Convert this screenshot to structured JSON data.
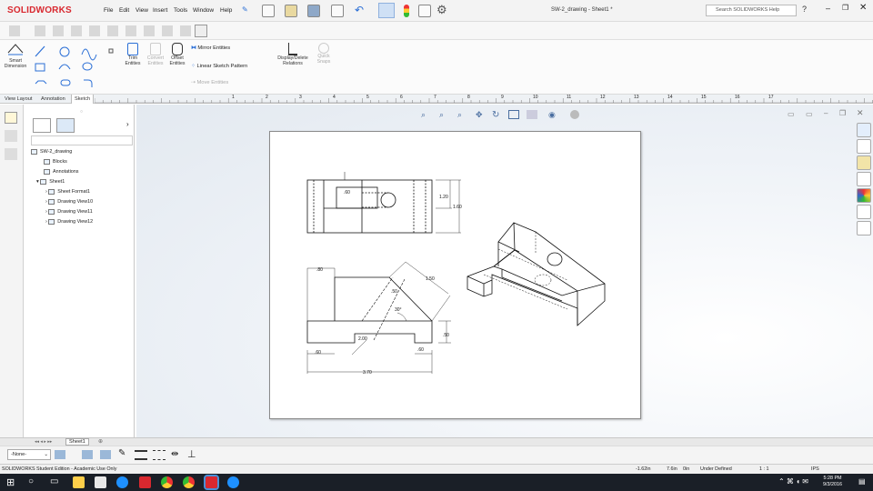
{
  "app": {
    "brand": "SOLIDWORKS",
    "window_title": "SW-2_drawing - Sheet1 *",
    "search_placeholder": "Search SOLIDWORKS Help"
  },
  "menu": [
    "File",
    "Edit",
    "View",
    "Insert",
    "Tools",
    "Window",
    "Help"
  ],
  "command_manager": {
    "smart_dimension": "Smart Dimension",
    "trim_entities": "Trim Entities",
    "convert_entities": "Convert Entities",
    "offset_entities": "Offset Entities",
    "mirror_entities": "Mirror Entities",
    "linear_sketch_pattern": "Linear Sketch Pattern",
    "move_entities": "Move Entities",
    "display_delete_relations": "Display/Delete Relations",
    "quick_snaps": "Quick Snaps"
  },
  "tabs": [
    "View Layout",
    "Annotation",
    "Sketch"
  ],
  "ruler_numbers": [
    "1",
    "2",
    "3",
    "4",
    "5",
    "6",
    "7",
    "8",
    "9",
    "10",
    "11",
    "12",
    "13",
    "14",
    "15",
    "16",
    "17"
  ],
  "tree": {
    "root": "SW-2_drawing",
    "items": [
      "Blocks",
      "Annotations",
      "Sheet1",
      "Sheet Format1",
      "Drawing View10",
      "Drawing View11",
      "Drawing View12"
    ]
  },
  "sheet_tab": "Sheet1",
  "layer": "-None-",
  "status": {
    "left": "SOLIDWORKS Student Edition - Academic Use Only",
    "x": "-1.62in",
    "y": "7.6in",
    "z": "0in",
    "defined": "Under Defined",
    "scale": "1 : 1",
    "units": "IPS"
  },
  "clock": {
    "time": "5:28 PM",
    "date": "9/3/2016"
  },
  "dimensions": {
    "top_small": ".60",
    "top_height": "1.20",
    "top_overall": "1.60",
    "front_80": ".80",
    "front_150": "1.50",
    "front_50a": ".50",
    "front_30": "30°",
    "front_200": "2.00",
    "front_50b": ".50",
    "front_60a": ".60",
    "front_60b": ".60",
    "front_370": "3.70"
  },
  "colors": {
    "brand_red": "#d9282f",
    "taskbar": "#1a1f27",
    "accent_blue": "#2b6fd6"
  }
}
